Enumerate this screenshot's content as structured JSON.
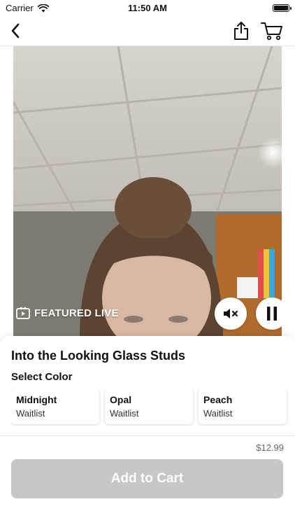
{
  "status_bar": {
    "carrier": "Carrier",
    "time": "11:50 AM"
  },
  "nav": {
    "back_icon": "chevron-left-icon",
    "share_icon": "share-icon",
    "cart_icon": "cart-icon"
  },
  "video": {
    "badge": "FEATURED LIVE",
    "badge_icon": "tv-play-icon",
    "mute_icon": "mute-icon",
    "pause_icon": "pause-icon"
  },
  "product": {
    "title": "Into the Looking Glass Studs",
    "select_label": "Select Color",
    "colors": [
      {
        "name": "Midnight",
        "status": "Waitlist"
      },
      {
        "name": "Opal",
        "status": "Waitlist"
      },
      {
        "name": "Peach",
        "status": "Waitlist"
      }
    ],
    "price": "$12.99",
    "add_to_cart_label": "Add to Cart",
    "button_color": "#c7c7c7"
  }
}
